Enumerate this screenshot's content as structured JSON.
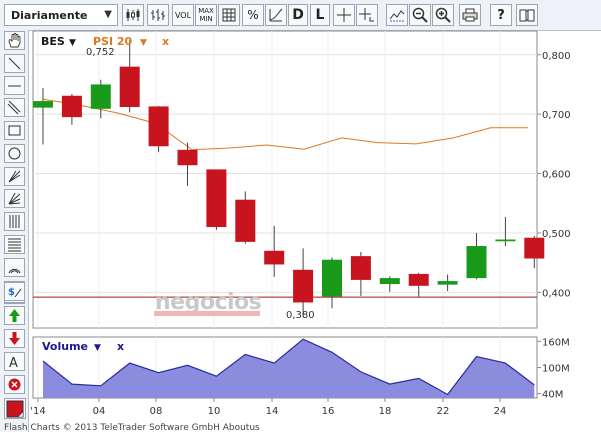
{
  "toolbar": {
    "interval": "Diariamente",
    "vol_label": "VOL",
    "maxmin_line1": "MAX",
    "maxmin_line2": "MIN",
    "percent_label": "%",
    "daily_label": "D",
    "line_label": "L",
    "help_label": "?"
  },
  "legend": {
    "symbol": "BES",
    "compare": "PSI 20",
    "remove": "x",
    "volume": "Volume",
    "volume_remove": "x"
  },
  "watermark": "negocios",
  "annotations": {
    "high": "0,752",
    "low": "0,380"
  },
  "footer": "Flash Charts © 2013 TeleTrader Software GmbH  Aboutus",
  "colors": {
    "up": "#1a9a1a",
    "down": "#c8141e",
    "compare_line": "#e07820",
    "volume_fill": "#8c8cde",
    "volume_line": "#2b2ba0",
    "ref_line": "#a01818",
    "legend_blue": "#1a1a8c",
    "legend_orange": "#e07820"
  },
  "chart_data": {
    "type": "candlestick",
    "x_labels": [
      "'14",
      "04",
      "08",
      "10",
      "14",
      "16",
      "18",
      "22",
      "24"
    ],
    "y_ticks": [
      "0,800",
      "0,700",
      "0,600",
      "0,500",
      "0,400"
    ],
    "ylim": [
      0.34,
      0.84
    ],
    "reference_line": 0.392,
    "candles": [
      {
        "open": 0.711,
        "close": 0.722,
        "high": 0.744,
        "low": 0.649
      },
      {
        "open": 0.731,
        "close": 0.695,
        "high": 0.734,
        "low": 0.682
      },
      {
        "open": 0.709,
        "close": 0.75,
        "high": 0.758,
        "low": 0.693
      },
      {
        "open": 0.78,
        "close": 0.712,
        "high": 0.825,
        "low": 0.703
      },
      {
        "open": 0.713,
        "close": 0.646,
        "high": 0.714,
        "low": 0.636
      },
      {
        "open": 0.64,
        "close": 0.614,
        "high": 0.652,
        "low": 0.579
      },
      {
        "open": 0.607,
        "close": 0.51,
        "high": 0.607,
        "low": 0.505
      },
      {
        "open": 0.556,
        "close": 0.485,
        "high": 0.57,
        "low": 0.482
      },
      {
        "open": 0.47,
        "close": 0.447,
        "high": 0.512,
        "low": 0.426
      },
      {
        "open": 0.438,
        "close": 0.383,
        "high": 0.474,
        "low": 0.359
      },
      {
        "open": 0.393,
        "close": 0.455,
        "high": 0.459,
        "low": 0.373
      },
      {
        "open": 0.461,
        "close": 0.421,
        "high": 0.468,
        "low": 0.394
      },
      {
        "open": 0.414,
        "close": 0.424,
        "high": 0.427,
        "low": 0.401
      },
      {
        "open": 0.431,
        "close": 0.411,
        "high": 0.433,
        "low": 0.393
      },
      {
        "open": 0.413,
        "close": 0.419,
        "high": 0.43,
        "low": 0.402
      },
      {
        "open": 0.424,
        "close": 0.478,
        "high": 0.5,
        "low": 0.422
      },
      {
        "open": 0.486,
        "close": 0.489,
        "high": 0.527,
        "low": 0.478
      },
      {
        "open": 0.492,
        "close": 0.457,
        "high": 0.495,
        "low": 0.441
      }
    ],
    "compare_series": {
      "name": "PSI 20",
      "values": [
        0.725,
        0.715,
        0.702,
        0.685,
        0.64,
        0.643,
        0.648,
        0.641,
        0.66,
        0.652,
        0.65,
        0.66,
        0.677,
        0.677
      ]
    },
    "volume": {
      "name": "Volume",
      "y_ticks": [
        "160M",
        "100M",
        "40M"
      ],
      "ylim": [
        30,
        170
      ],
      "values": [
        115,
        62,
        58,
        110,
        88,
        105,
        80,
        130,
        110,
        165,
        135,
        90,
        62,
        75,
        38,
        125,
        110,
        60
      ]
    }
  }
}
